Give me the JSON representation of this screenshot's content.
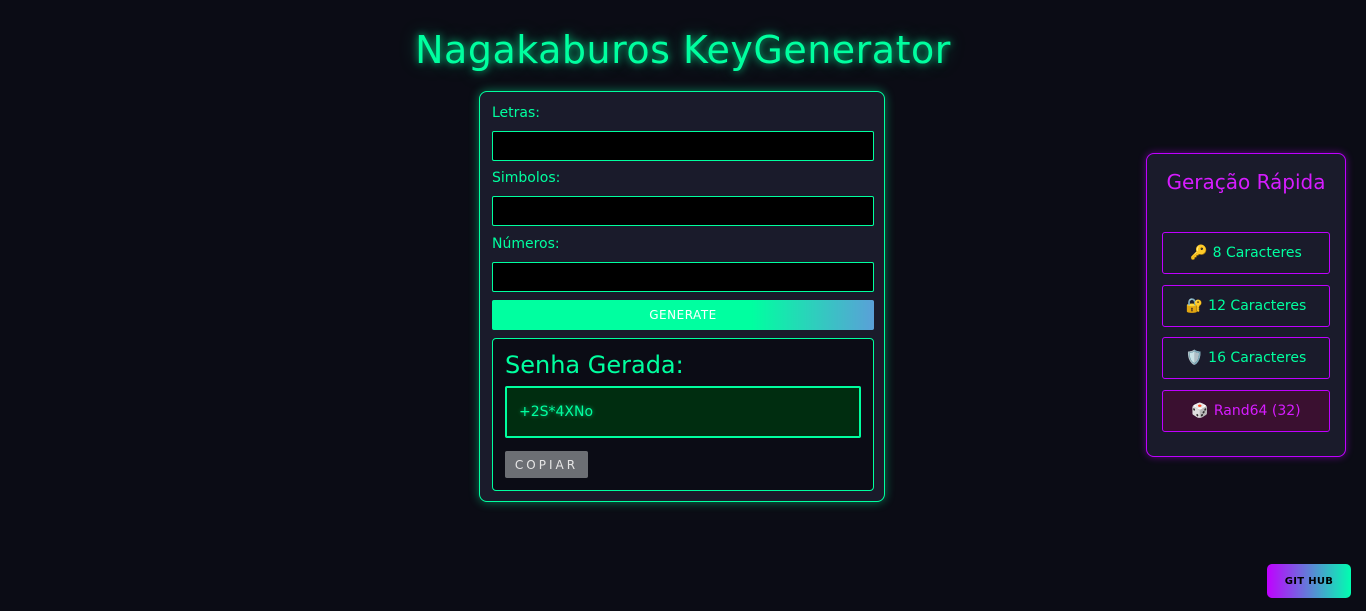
{
  "app": {
    "title": "Nagakaburos KeyGenerator"
  },
  "form": {
    "letters_label": "Letras:",
    "letters_value": "",
    "symbols_label": "Simbolos:",
    "symbols_value": "",
    "numbers_label": "Números:",
    "numbers_value": "",
    "generate_label": "GENERATE"
  },
  "result": {
    "title": "Senha Gerada:",
    "password": "+2S*4XNo",
    "copy_label": "COPIAR"
  },
  "quick": {
    "title": "Geração Rápida",
    "buttons": [
      {
        "icon": "🔑",
        "icon_name": "key-icon",
        "label": "8 Caracteres"
      },
      {
        "icon": "🔐",
        "icon_name": "locked-with-key-icon",
        "label": "12 Caracteres"
      },
      {
        "icon": "🛡️",
        "icon_name": "shield-icon",
        "label": "16 Caracteres"
      },
      {
        "icon": "🎲",
        "icon_name": "dice-icon",
        "label": "Rand64 (32)"
      }
    ]
  },
  "footer": {
    "github_label": "GIT HUB"
  },
  "colors": {
    "background": "#0b0c15",
    "neon_green": "#00ff9f",
    "neon_purple": "#bf00ff",
    "card": "#1a1b2b"
  }
}
